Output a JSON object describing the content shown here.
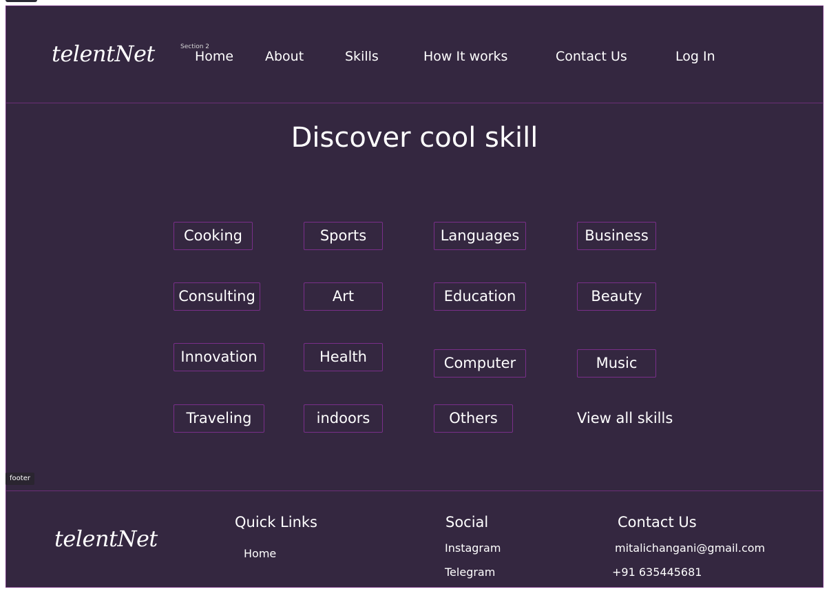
{
  "brand": {
    "logo": "telentNet"
  },
  "annotations": {
    "section_label": "Section 2",
    "footer_label": "footer"
  },
  "nav": {
    "items": [
      "Home",
      "About",
      "Skills",
      "How It works",
      "Contact Us",
      "Log In"
    ]
  },
  "hero": {
    "title": "Discover cool skill"
  },
  "skills": {
    "items": [
      "Cooking",
      "Sports",
      "Languages",
      "Business",
      "Consulting",
      "Art",
      "Education",
      "Beauty",
      "Innovation",
      "Health",
      "Computer",
      "Music",
      "Traveling",
      "indoors",
      "Others"
    ],
    "view_all": "View all skills"
  },
  "footer": {
    "quick_links": {
      "heading": "Quick Links",
      "items": [
        "Home"
      ]
    },
    "social": {
      "heading": "Social",
      "items": [
        "Instagram",
        "Telegram"
      ]
    },
    "contact": {
      "heading": "Contact Us",
      "email": "mitalichangani@gmail.com",
      "phone": "+91 635445681"
    }
  },
  "colors": {
    "background": "#342740",
    "border": "#6b2f78",
    "text": "#ffffff"
  }
}
